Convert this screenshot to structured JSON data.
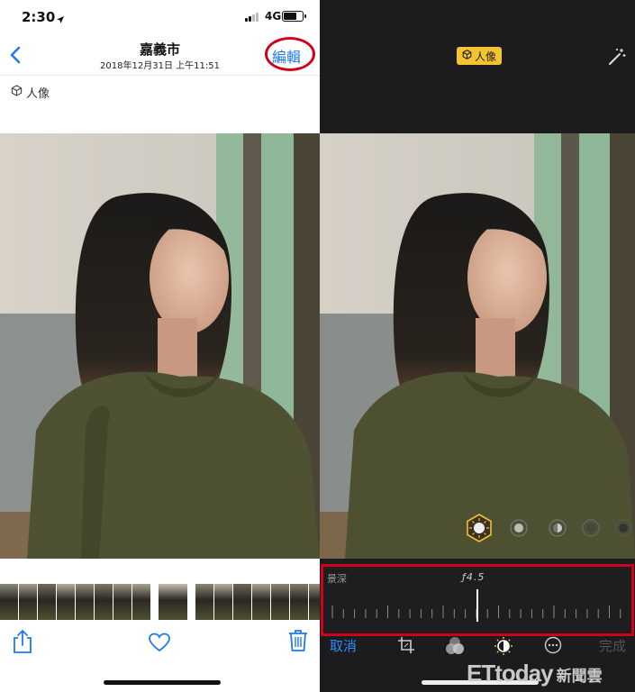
{
  "status_bar": {
    "time": "2:30",
    "network": "4G",
    "battery_level": 0.75
  },
  "nav": {
    "title": "嘉義市",
    "subtitle": "2018年12月31日  上午11:51",
    "edit_label": "編輯"
  },
  "left": {
    "mode_tag": "人像"
  },
  "right": {
    "mode_badge": "人像",
    "depth_label": "景深",
    "fstop": "ƒ4.5",
    "cancel_label": "取消",
    "done_label": "完成"
  },
  "watermark": {
    "brand": "ETtoday",
    "sub": "新聞雲"
  },
  "colors": {
    "accent_blue": "#1f7aec",
    "highlight_red": "#d0021b",
    "badge_yellow": "#f5c232"
  },
  "icons": [
    "location-arrow-icon",
    "signal-icon",
    "battery-icon",
    "back-chevron-icon",
    "cube-icon",
    "share-icon",
    "heart-icon",
    "trash-icon",
    "magic-wand-icon",
    "crop-icon",
    "filters-icon",
    "adjust-icon",
    "more-icon"
  ]
}
